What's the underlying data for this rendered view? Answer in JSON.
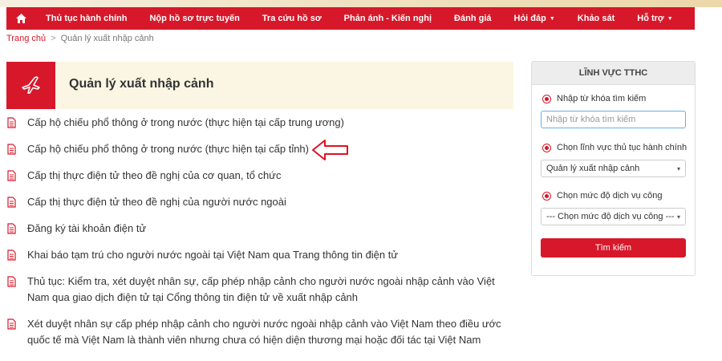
{
  "nav": {
    "items": [
      "Thủ tục hành chính",
      "Nộp hồ sơ trực tuyến",
      "Tra cứu hồ sơ",
      "Phản ánh - Kiến nghị",
      "Đánh giá",
      "Hỏi đáp",
      "Khảo sát",
      "Hỗ trợ"
    ],
    "dropdown_items": [
      "Hỏi đáp",
      "Hỗ trợ"
    ]
  },
  "breadcrumb": {
    "home": "Trang chủ",
    "separator": ">",
    "current": "Quản lý xuất nhập cảnh"
  },
  "page_title": "Quản lý xuất nhập cảnh",
  "procedures": [
    "Cấp hộ chiếu phổ thông ở trong nước (thực hiện tại cấp trung ương)",
    "Cấp hộ chiếu phổ thông ở trong nước (thực hiện tại cấp tỉnh)",
    "Cấp thị thực điện tử theo đề nghị của cơ quan, tổ chức",
    "Cấp thị thực điện tử theo đề nghị của người nước ngoài",
    "Đăng ký tài khoản điện tử",
    "Khai báo tạm trú cho người nước ngoài tại Việt Nam qua Trang thông tin điện tử",
    "Thủ tục: Kiểm tra, xét duyệt nhân sự, cấp phép nhập cảnh cho người nước ngoài nhập cảnh vào Việt Nam qua giao dịch điện tử tại Cổng thông tin điện tử về xuất nhập cảnh",
    "Xét duyệt nhân sự cấp phép nhập cảnh cho người nước ngoài nhập cảnh vào Việt Nam theo điều ước quốc tế mà Việt Nam là thành viên nhưng chưa có hiện diện thương mại hoặc đối tác tại Việt Nam"
  ],
  "sidebar": {
    "title": "LĨNH VỰC TTHC",
    "keyword_label": "Nhập từ khóa tìm kiếm",
    "keyword_placeholder": "Nhập từ khóa tìm kiếm",
    "field_label": "Chọn lĩnh vực thủ tục hành chính",
    "field_value": "Quản lý xuất nhập cảnh",
    "level_label": "Chọn mức độ dịch vụ công",
    "level_value": "--- Chọn mức độ dịch vụ công ---",
    "search_button": "Tìm kiếm"
  },
  "colors": {
    "brand_red": "#d7182a",
    "header_bg": "#fbf6e4"
  },
  "icons": {
    "home": "home-icon",
    "page": "airplane-icon",
    "item": "document-icon",
    "annotation": "left-arrow-annotation"
  }
}
